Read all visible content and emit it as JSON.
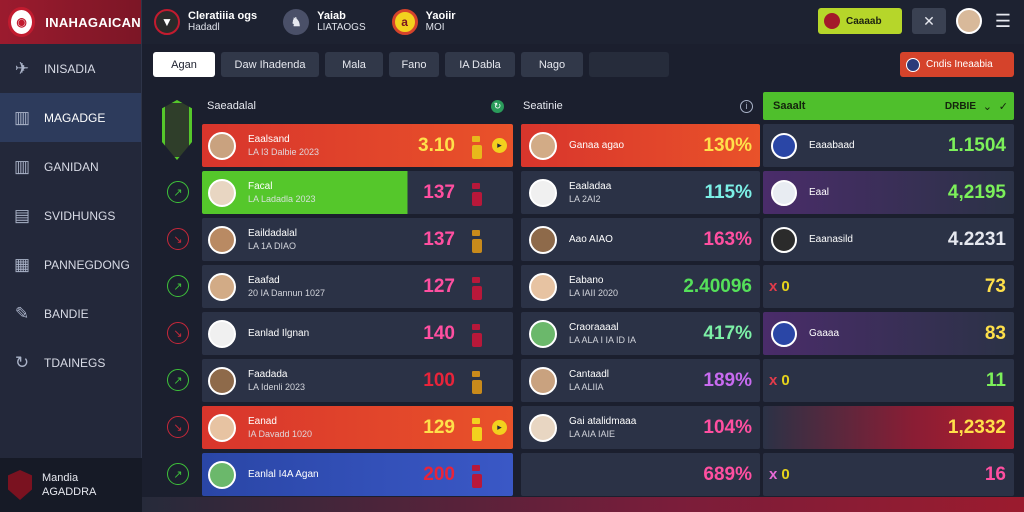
{
  "app": {
    "name": "INAHAGAICAN"
  },
  "sidebar": {
    "items": [
      {
        "label": "INISADIA",
        "icon": "plane-icon",
        "active": false
      },
      {
        "label": "MAGADGE",
        "icon": "chart-icon",
        "active": true
      },
      {
        "label": "GANIDAN",
        "icon": "chart-icon",
        "active": false
      },
      {
        "label": "SVIDHUNGS",
        "icon": "document-icon",
        "active": false
      },
      {
        "label": "PANNEGDONG",
        "icon": "layout-icon",
        "active": false
      },
      {
        "label": "BANDIE",
        "icon": "pen-icon",
        "active": false
      },
      {
        "label": "TDAINEGS",
        "icon": "refresh-icon",
        "active": false
      }
    ],
    "footer": {
      "line1": "Mandia",
      "line2": "AGADDRA"
    }
  },
  "topbar": {
    "teams": [
      {
        "title": "Cleratiiia",
        "extra": "ogs",
        "sub": "Hadadl"
      },
      {
        "title": "Yaiab",
        "sub": "LIATAOGS"
      },
      {
        "title": "Yaoiir",
        "sub": "MOI"
      }
    ],
    "pill_label": "Caaaab",
    "close_icon": "✕",
    "menu_icon": "☰"
  },
  "tabs": [
    "Agan",
    "Daw Ihadenda",
    "Mala",
    "Fano",
    "IA Dabla",
    "Nago",
    ""
  ],
  "action_button": "Cndis Ineaabia",
  "columns": {
    "left": {
      "title": "Saeadalal"
    },
    "mid": {
      "title": "Seatinie"
    },
    "right": {
      "title": "Saaalt",
      "status": "DRBIE"
    }
  },
  "colors": {
    "red": "#d23a2c",
    "green": "#55c72b",
    "blue": "#2a46a6",
    "yellow": "#f2d11e",
    "pink": "#ff4fa0"
  },
  "left_rows": [
    {
      "marker": "crest",
      "name": "Eaalsand",
      "sub": "LA I3 Dalbie 2023",
      "value": "3.10",
      "bg": "red",
      "value_color": "#ffe04a",
      "ind": "#e8b81b",
      "ind_top": "#e8b81b"
    },
    {
      "marker": "green",
      "name": "Facal",
      "sub": "LA Ladadla 2023",
      "value": "137",
      "bg": "green",
      "value_color": "#ff4fa0",
      "ind": "#b8183a",
      "ind_top": "#b8183a"
    },
    {
      "marker": "red",
      "name": "Eaildadalal",
      "sub": "LA 1A DIAO",
      "value": "137",
      "bg": "dark",
      "value_color": "#ff4fa0",
      "ind": "#c88a1b",
      "ind_top": "#c88a1b"
    },
    {
      "marker": "green",
      "name": "Eaafad",
      "sub": "20 IA Dannun 1027",
      "value": "127",
      "bg": "dark",
      "value_color": "#ff4fa0",
      "ind": "#b8183a",
      "ind_top": "#b8183a"
    },
    {
      "marker": "red",
      "name": "Eanlad Ilgnan",
      "sub": "",
      "value": "140",
      "bg": "dark",
      "value_color": "#ff4fa0",
      "ind": "#b8183a",
      "ind_top": "#b8183a"
    },
    {
      "marker": "green",
      "name": "Faadada",
      "sub": "LA Idenli 2023",
      "value": "100",
      "bg": "dark",
      "value_color": "#e8243a",
      "ind": "#c88a1b",
      "ind_top": "#c88a1b"
    },
    {
      "marker": "red",
      "name": "Eanad",
      "sub": "IA Davadd 1020",
      "value": "129",
      "bg": "red",
      "value_color": "#ffe04a",
      "ind": "#f2d11e",
      "ind_top": "#f2d11e"
    },
    {
      "marker": "green",
      "name": "Eanlal I4A Agan",
      "sub": "",
      "value": "200",
      "bg": "blue",
      "value_color": "#e8243a",
      "ind": "#b8183a",
      "ind_top": "#b8183a"
    }
  ],
  "mid_rows": [
    {
      "name": "Ganaa agao",
      "sub": "",
      "value": "130%",
      "bg": "red",
      "value_color": "#ffe04a"
    },
    {
      "name": "Eaaladaa",
      "sub": "LA 2AI2",
      "value": "115%",
      "bg": "dark",
      "value_color": "#7cf0e6"
    },
    {
      "name": "Aao AIAO",
      "sub": "",
      "value": "163%",
      "bg": "dark",
      "value_color": "#ff4fa0"
    },
    {
      "name": "Eabano",
      "sub": "LA IAII 2020",
      "value": "2.40096",
      "bg": "dark",
      "value_color": "#55e05a"
    },
    {
      "name": "Craoraaaal",
      "sub": "LA ALA I IA ID IA",
      "value": "417%",
      "bg": "dark",
      "value_color": "#7cf0a6"
    },
    {
      "name": "Cantaadl",
      "sub": "LA ALIIA",
      "value": "189%",
      "bg": "dark",
      "value_color": "#c86bf0"
    },
    {
      "name": "Gai atalidmaaa",
      "sub": "LA AIA IAIE",
      "value": "104%",
      "bg": "dark",
      "value_color": "#ff4fa0"
    },
    {
      "name": "",
      "sub": "",
      "value": "689%",
      "bg": "dark",
      "value_color": "#ff4fa0"
    }
  ],
  "right_rows": [
    {
      "kind": "team",
      "name": "Eaaabaad",
      "value": "1.1504",
      "bg": "dark",
      "value_color": "#7cf05a"
    },
    {
      "kind": "team",
      "name": "Eaal",
      "value": "4,2195",
      "bg": "purple",
      "value_color": "#7cf05a"
    },
    {
      "kind": "team",
      "name": "Eaanasild",
      "value": "4.2231",
      "bg": "dark",
      "value_color": "#e6e8ef"
    },
    {
      "kind": "x",
      "x": "x",
      "zero": "0",
      "x_color": "red",
      "value": "73",
      "bg": "dark",
      "value_color": "#ffe04a"
    },
    {
      "kind": "team",
      "name": "Gaaaa",
      "value": "83",
      "bg": "purple",
      "value_color": "#ffe04a"
    },
    {
      "kind": "x",
      "x": "x",
      "zero": "0",
      "x_color": "red",
      "value": "11",
      "bg": "dark",
      "value_color": "#7cf05a"
    },
    {
      "kind": "blank",
      "value": "1,2332",
      "bg": "redgrad",
      "value_color": "#ffe04a"
    },
    {
      "kind": "x",
      "x": "x",
      "zero": "0",
      "x_color": "pink",
      "value": "16",
      "bg": "dark",
      "value_color": "#ff4fa0"
    }
  ]
}
